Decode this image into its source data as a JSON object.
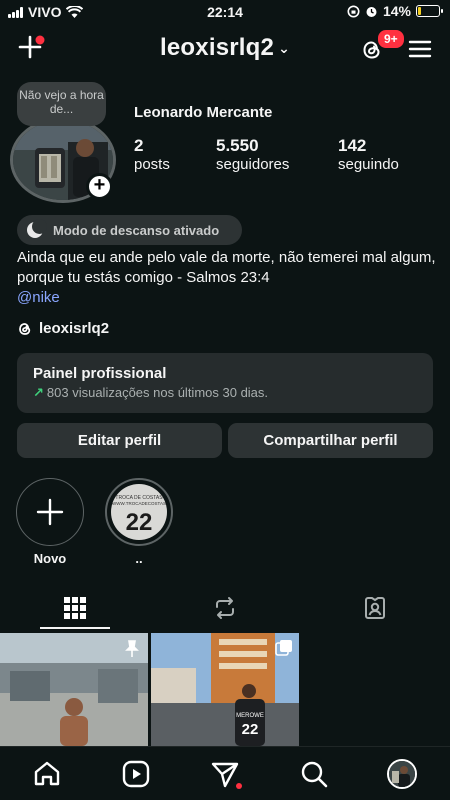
{
  "status_bar": {
    "carrier": "VIVO",
    "time": "22:14",
    "battery": "14%",
    "battery_level": 0.14
  },
  "header": {
    "username": "leoxisrlq2",
    "notification_badge": "9+"
  },
  "profile": {
    "note": "Não vejo a hora de...",
    "name": "Leonardo Mercante",
    "stats": [
      {
        "value": "2",
        "label": "posts"
      },
      {
        "value": "5.550",
        "label": "seguidores"
      },
      {
        "value": "142",
        "label": "seguindo"
      }
    ],
    "rest_mode": "Modo de descanso ativado",
    "bio": "Ainda que eu ande pelo vale da morte, não temerei mal algum, porque tu estás comigo - Salmos 23:4",
    "mention": "@nike",
    "threads_handle": "leoxisrlq2"
  },
  "dashboard": {
    "title": "Painel profissional",
    "subtitle": "803 visualizações nos últimos 30 dias."
  },
  "actions": {
    "edit": "Editar perfil",
    "share": "Compartilhar perfil"
  },
  "highlights": [
    {
      "label": "Novo"
    },
    {
      "label": ".."
    }
  ],
  "highlight_cover_text": {
    "line1": "TROCA DE COSTAS",
    "line2": "WWW.TROCADECOSTAS",
    "number": "22"
  },
  "posts": [
    {
      "shirt_text": ""
    },
    {
      "shirt_text": "MEROWE",
      "number": "22"
    }
  ],
  "colors": {
    "background": "#0c1414",
    "accent_red": "#ff3040",
    "link_blue": "#8aa6ff",
    "growth_green": "#3fd27c"
  }
}
